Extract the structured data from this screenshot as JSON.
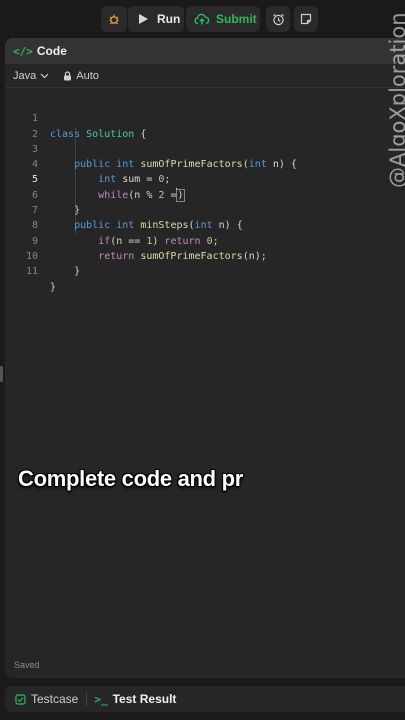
{
  "toolbar": {
    "run_label": "Run",
    "submit_label": "Submit",
    "debug_icon": "bug-icon",
    "alarm_icon": "alarm-clock-icon",
    "note_icon": "note-icon",
    "accent_green": "#2cbb5d"
  },
  "panel": {
    "title": "Code",
    "language": "Java",
    "mode": "Auto",
    "status": "Saved"
  },
  "code": {
    "active_line": 5,
    "lines": [
      {
        "num": "1"
      },
      {
        "num": "2"
      },
      {
        "num": "3"
      },
      {
        "num": "4"
      },
      {
        "num": "5"
      },
      {
        "num": "6"
      },
      {
        "num": "7"
      },
      {
        "num": "8"
      },
      {
        "num": "9"
      },
      {
        "num": "10"
      },
      {
        "num": "11"
      }
    ],
    "tokens": {
      "l1": [
        "class",
        "Solution",
        "{"
      ],
      "l3": [
        "public",
        "int",
        "sumOfPrimeFactors",
        "(",
        "int",
        "n) {"
      ],
      "l4": [
        "int",
        "sum = ",
        "0",
        ";"
      ],
      "l5": [
        "while",
        "(n % ",
        "2",
        " ="
      ],
      "l6": [
        "}"
      ],
      "l7": [
        "public",
        "int",
        "minSteps",
        "(",
        "int",
        "n) {"
      ],
      "l8": [
        "if",
        "(n == ",
        "1",
        ") ",
        "return",
        "0",
        ";"
      ],
      "l9": [
        "return",
        "sumOfPrimeFactors",
        "(n);"
      ],
      "l10": [
        "}"
      ],
      "l11": [
        "}"
      ]
    }
  },
  "overlay": {
    "caption": "Complete code and pr"
  },
  "bottom": {
    "testcase_label": "Testcase",
    "result_label": "Test Result"
  },
  "watermark": {
    "text": "@AlgoXploration"
  }
}
